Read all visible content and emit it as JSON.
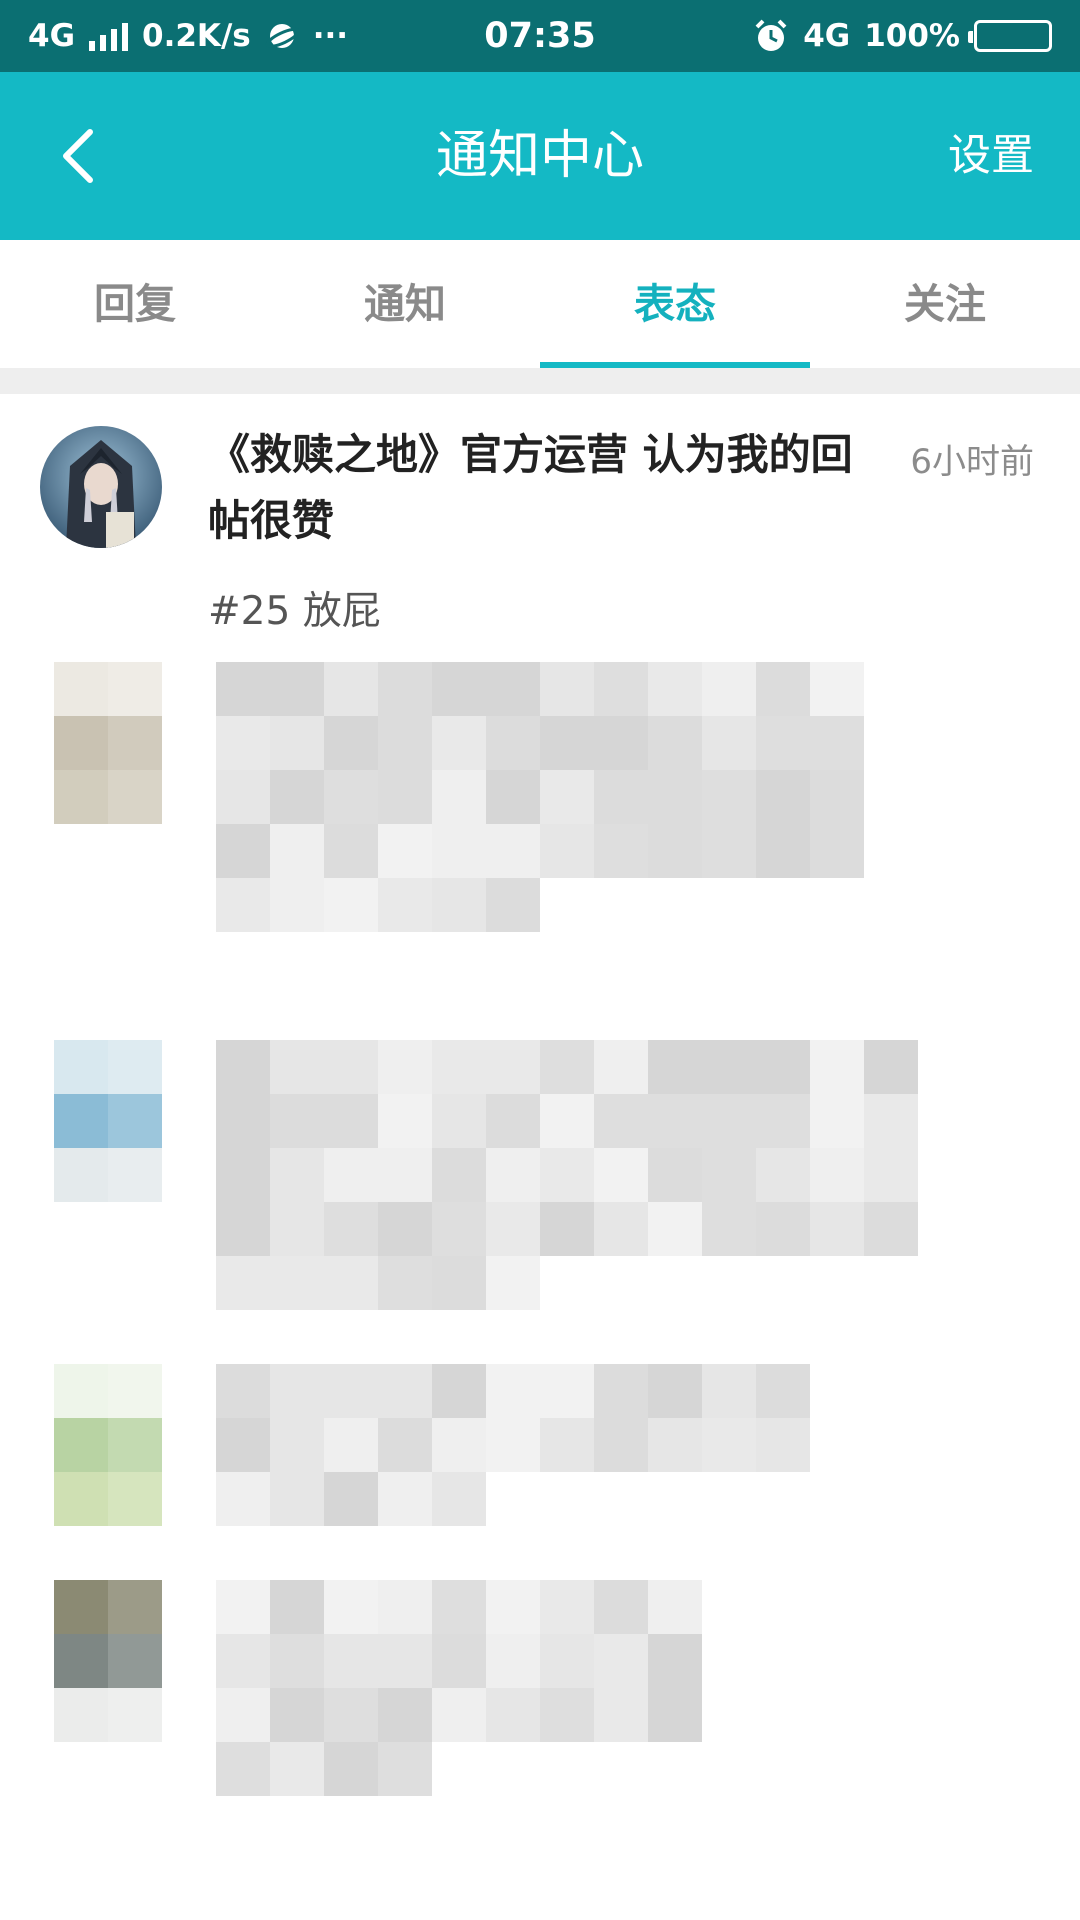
{
  "status_bar": {
    "network": "4G",
    "speed": "0.2K/s",
    "more": "···",
    "time": "07:35",
    "network_right": "4G",
    "battery": "100%"
  },
  "app_bar": {
    "title": "通知中心",
    "settings_label": "设置"
  },
  "tabs": [
    {
      "label": "回复",
      "active": false
    },
    {
      "label": "通知",
      "active": false
    },
    {
      "label": "表态",
      "active": true
    },
    {
      "label": "关注",
      "active": false
    }
  ],
  "notifications": [
    {
      "headline": "《救赎之地》官方运营 认为我的回帖很赞",
      "time": "6小时前",
      "quote": "#25 放屁"
    }
  ],
  "colors": {
    "status_bar": "#0b6f72",
    "app_bar": "#14b9c5",
    "accent": "#14b1be"
  }
}
